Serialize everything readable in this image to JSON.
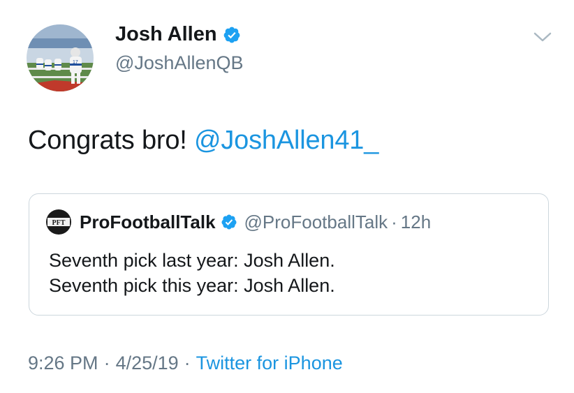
{
  "author": {
    "display_name": "Josh Allen",
    "handle": "@JoshAllenQB",
    "verified": true
  },
  "tweet": {
    "text_prefix": "Congrats bro! ",
    "mention": "@JoshAllen41_"
  },
  "quoted_tweet": {
    "display_name": "ProFootballTalk",
    "handle": "@ProFootballTalk",
    "separator": "·",
    "time": "12h",
    "avatar_text": "PFT",
    "line1": "Seventh pick last year: Josh Allen.",
    "line2": "Seventh pick this year: Josh Allen."
  },
  "meta": {
    "time": "9:26 PM",
    "sep1": "·",
    "date": "4/25/19",
    "sep2": "·",
    "source": "Twitter for iPhone"
  },
  "icons": {
    "verified": "verified-badge-icon",
    "menu": "chevron-down-icon"
  },
  "colors": {
    "link": "#1b95e0",
    "secondary": "#657786",
    "verified": "#1da1f2",
    "border": "#ccd6dd"
  }
}
